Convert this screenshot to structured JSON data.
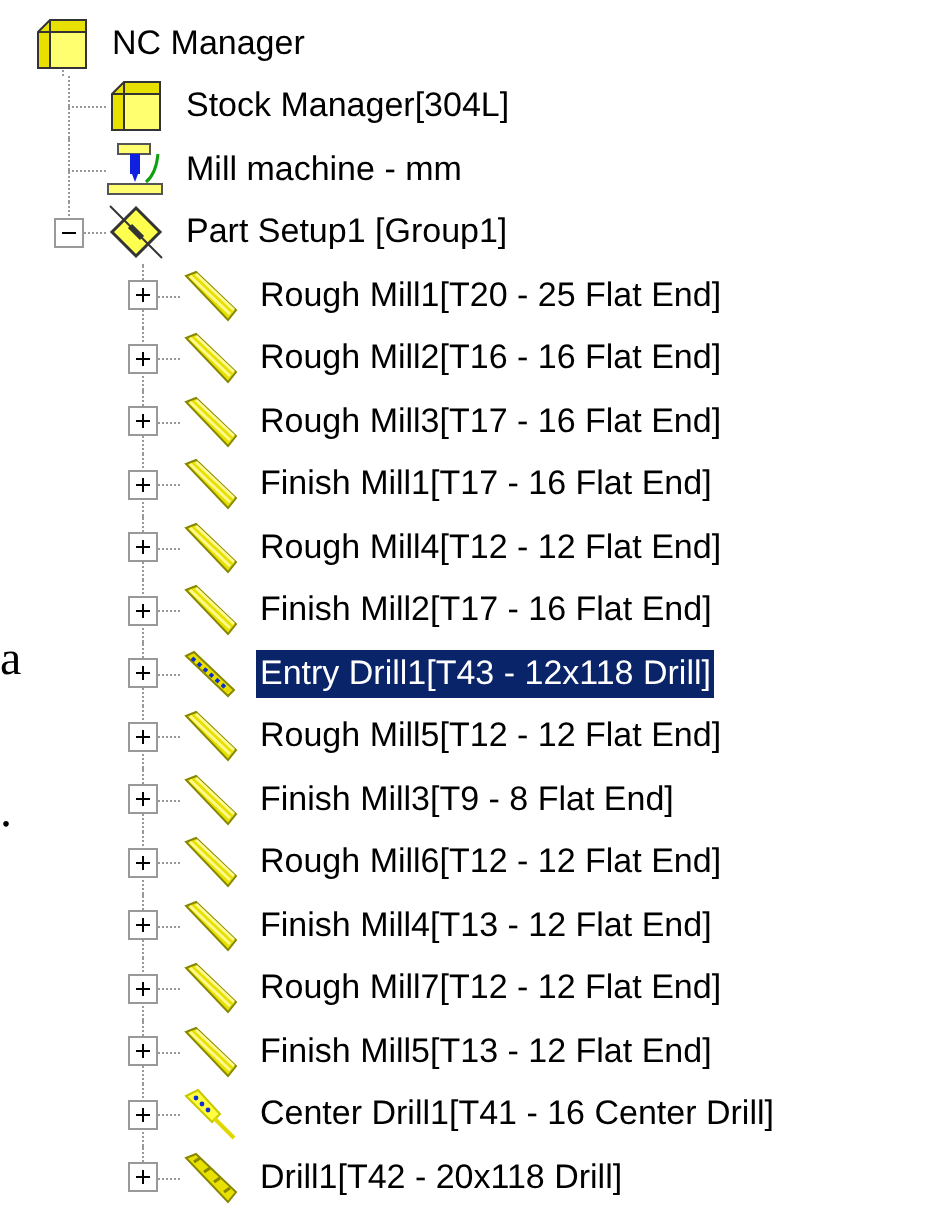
{
  "margin_fragments": [
    "a",
    "."
  ],
  "tree": {
    "label": "NC Manager",
    "kind": "box",
    "selected": false,
    "children": [
      {
        "label": "Stock Manager[304L]",
        "kind": "box",
        "selected": false
      },
      {
        "label": "Mill machine - mm",
        "kind": "machine",
        "selected": false
      },
      {
        "label": "Part Setup1 [Group1]",
        "kind": "setup",
        "selected": false,
        "expanded": true,
        "children": [
          {
            "label": "Rough Mill1[T20 - 25 Flat End]",
            "kind": "mill",
            "selected": false,
            "expanded": false
          },
          {
            "label": "Rough Mill2[T16 - 16 Flat End]",
            "kind": "mill",
            "selected": false,
            "expanded": false
          },
          {
            "label": "Rough Mill3[T17 - 16 Flat End]",
            "kind": "mill",
            "selected": false,
            "expanded": false
          },
          {
            "label": "Finish Mill1[T17 - 16 Flat End]",
            "kind": "mill",
            "selected": false,
            "expanded": false
          },
          {
            "label": "Rough Mill4[T12 - 12 Flat End]",
            "kind": "mill",
            "selected": false,
            "expanded": false
          },
          {
            "label": "Finish Mill2[T17 - 16 Flat End]",
            "kind": "mill",
            "selected": false,
            "expanded": false
          },
          {
            "label": "Entry Drill1[T43 - 12x118 Drill]",
            "kind": "entry_drill",
            "selected": true,
            "expanded": false
          },
          {
            "label": "Rough Mill5[T12 - 12 Flat End]",
            "kind": "mill",
            "selected": false,
            "expanded": false
          },
          {
            "label": "Finish Mill3[T9 - 8 Flat End]",
            "kind": "mill",
            "selected": false,
            "expanded": false
          },
          {
            "label": "Rough Mill6[T12 - 12 Flat End]",
            "kind": "mill",
            "selected": false,
            "expanded": false
          },
          {
            "label": "Finish Mill4[T13 - 12 Flat End]",
            "kind": "mill",
            "selected": false,
            "expanded": false
          },
          {
            "label": "Rough Mill7[T12 - 12 Flat End]",
            "kind": "mill",
            "selected": false,
            "expanded": false
          },
          {
            "label": "Finish Mill5[T13 - 12 Flat End]",
            "kind": "mill",
            "selected": false,
            "expanded": false
          },
          {
            "label": "Center Drill1[T41 - 16 Center Drill]",
            "kind": "center_drill",
            "selected": false,
            "expanded": false
          },
          {
            "label": "Drill1[T42 - 20x118 Drill]",
            "kind": "drill",
            "selected": false,
            "expanded": false
          }
        ]
      }
    ]
  }
}
